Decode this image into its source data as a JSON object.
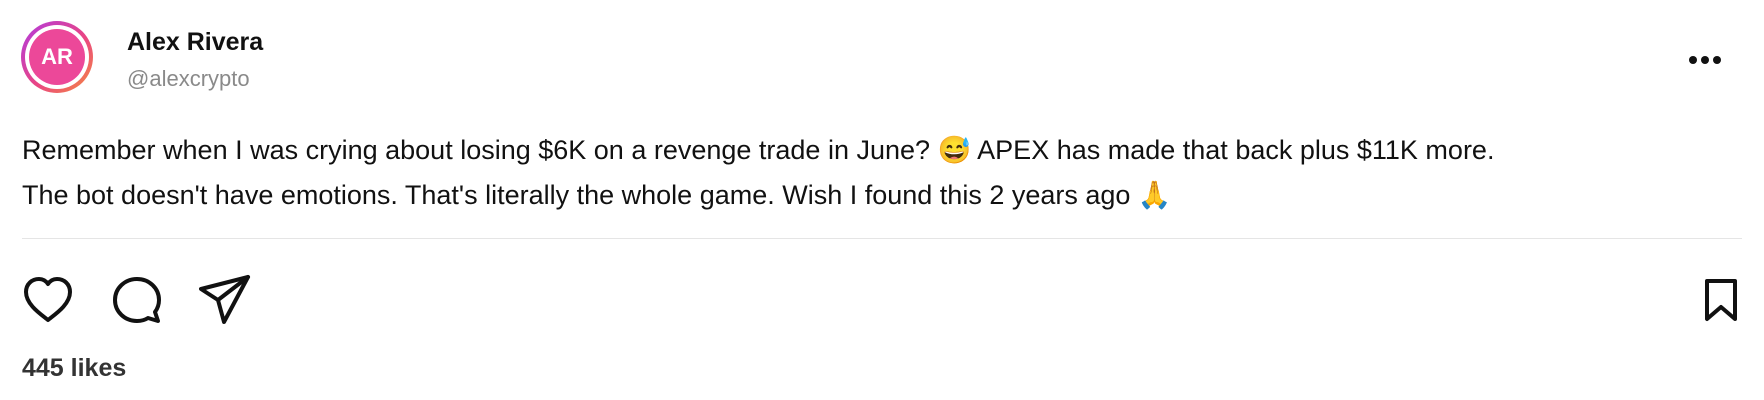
{
  "author": {
    "initials": "AR",
    "name": "Alex Rivera",
    "handle": "@alexcrypto"
  },
  "post": {
    "line1": "Remember when I was crying about losing $6K on a revenge trade in June? 😅 APEX has made that back plus $11K more.",
    "line2": "The bot doesn't have emotions. That's literally the whole game. Wish I found this 2 years ago 🙏"
  },
  "engagement": {
    "likes_label": "445 likes"
  },
  "icons": {
    "more": "more-horizontal-icon",
    "like": "heart-icon",
    "comment": "comment-icon",
    "share": "send-icon",
    "save": "bookmark-icon"
  },
  "colors": {
    "avatar_fill": "#ec4899",
    "text": "#111111",
    "muted": "#8a8a8a",
    "divider": "#e5e5e5"
  }
}
